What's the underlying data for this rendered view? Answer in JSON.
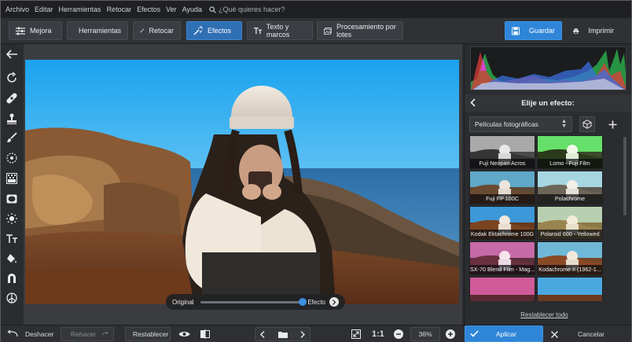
{
  "menu": {
    "items": [
      "Archivo",
      "Editar",
      "Herramientas",
      "Retocar",
      "Efectos",
      "Ver",
      "Ayuda"
    ],
    "search_placeholder": "¿Qué quieres hacer?"
  },
  "toolbar": {
    "tabs": [
      {
        "label": "Mejora",
        "icon": "sliders-icon"
      },
      {
        "label": "Herramientas",
        "icon": "crop-icon"
      },
      {
        "label": "Retocar",
        "icon": "brush-icon"
      },
      {
        "label": "Efectos",
        "icon": "magic-wand-icon",
        "active": true
      },
      {
        "label": "Texto y marcos",
        "icon": "text-icon"
      },
      {
        "label": "Procesamiento por lotes",
        "icon": "images-icon"
      }
    ],
    "save_label": "Guardar",
    "print_label": "Imprimir"
  },
  "rail": {
    "tools": [
      "back-arrow-icon",
      "rotate-icon",
      "bandage-icon",
      "stamp-icon",
      "brush-icon",
      "radial-filter-icon",
      "gradient-icon",
      "vignette-icon",
      "light-icon",
      "text-icon",
      "fill-icon",
      "magnet-icon",
      "pin-icon"
    ]
  },
  "compare": {
    "original_label": "Original",
    "effect_label": "Efecto",
    "slider_position": 1.0
  },
  "panel": {
    "title": "Elije un efecto:",
    "category": "Películas fotográficas",
    "effects": [
      "Fuji Neopan Acros",
      "Lomo - Fuji Film",
      "Fuji FP 100C",
      "Polachrome",
      "Kodak Ektachrome 100G",
      "Polaroid 600 - Yellowed",
      "SX-70 Blend Film - Mag...",
      "Kodachrome II (1962-1...",
      "",
      ""
    ],
    "reset_all": "Restablecer todo"
  },
  "bottom": {
    "undo": "Deshacer",
    "redo": "Rehacer",
    "reset": "Restablecer",
    "ratio": "1:1",
    "zoom": "36%",
    "apply": "Aplicar",
    "cancel": "Cancelar"
  },
  "colors": {
    "accent": "#2f86d8",
    "active_tab": "#2f6fb3",
    "background": "#2a2c2f"
  }
}
